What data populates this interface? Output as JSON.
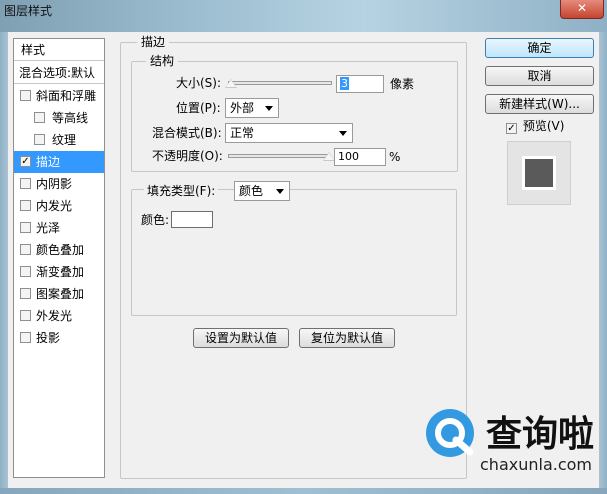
{
  "window": {
    "title": "图层样式",
    "close_glyph": "✕"
  },
  "sidebar": {
    "header_label": "样式",
    "blend_label": "混合选项:默认",
    "items": [
      {
        "label": "斜面和浮雕",
        "checked": false,
        "indent": false,
        "selected": false
      },
      {
        "label": "等高线",
        "checked": false,
        "indent": true,
        "selected": false
      },
      {
        "label": "纹理",
        "checked": false,
        "indent": true,
        "selected": false
      },
      {
        "label": "描边",
        "checked": true,
        "indent": false,
        "selected": true
      },
      {
        "label": "内阴影",
        "checked": false,
        "indent": false,
        "selected": false
      },
      {
        "label": "内发光",
        "checked": false,
        "indent": false,
        "selected": false
      },
      {
        "label": "光泽",
        "checked": false,
        "indent": false,
        "selected": false
      },
      {
        "label": "颜色叠加",
        "checked": false,
        "indent": false,
        "selected": false
      },
      {
        "label": "渐变叠加",
        "checked": false,
        "indent": false,
        "selected": false
      },
      {
        "label": "图案叠加",
        "checked": false,
        "indent": false,
        "selected": false
      },
      {
        "label": "外发光",
        "checked": false,
        "indent": false,
        "selected": false
      },
      {
        "label": "投影",
        "checked": false,
        "indent": false,
        "selected": false
      }
    ]
  },
  "stroke": {
    "group_title": "描边",
    "structure_title": "结构",
    "size_label": "大小(S):",
    "size_value": "3",
    "size_unit": "像素",
    "size_slider_fraction": 0.01,
    "position_label": "位置(P):",
    "position_value": "外部",
    "blend_mode_label": "混合模式(B):",
    "blend_mode_value": "正常",
    "opacity_label": "不透明度(O):",
    "opacity_value": "100",
    "opacity_unit": "%",
    "opacity_slider_fraction": 1.0,
    "fill_type_label": "填充类型(F):",
    "fill_type_value": "颜色",
    "color_label": "颜色:",
    "color_value": "#ffffff",
    "make_default_label": "设置为默认值",
    "reset_default_label": "复位为默认值"
  },
  "buttons": {
    "ok_label": "确定",
    "cancel_label": "取消",
    "new_style_label": "新建样式(W)...",
    "preview_label": "预览(V)",
    "preview_checked": true
  },
  "preview_swatch": {
    "fill": "#5a5a5a",
    "border": "#ffffff"
  },
  "watermark": {
    "brand": "查询啦",
    "url": "chaxunla.com",
    "icon_color": "#1e90e0"
  }
}
